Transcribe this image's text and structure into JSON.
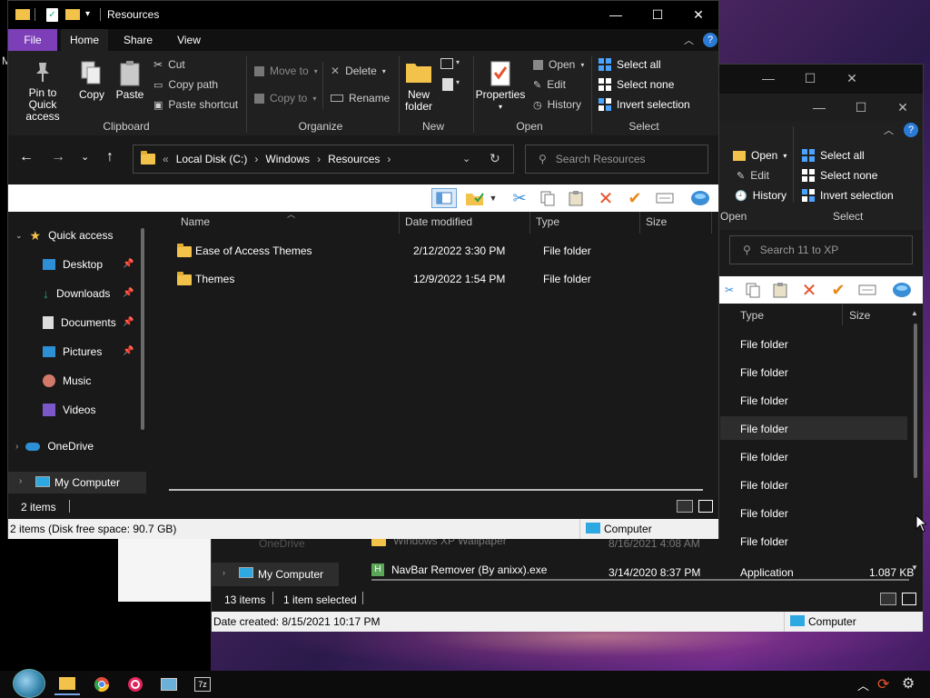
{
  "front": {
    "title": "Resources",
    "tabs": {
      "file": "File",
      "home": "Home",
      "share": "Share",
      "view": "View"
    },
    "ribbon": {
      "clipboard": {
        "label": "Clipboard",
        "pin": "Pin to Quick access",
        "copy": "Copy",
        "paste": "Paste",
        "cut": "Cut",
        "copy_path": "Copy path",
        "paste_shortcut": "Paste shortcut"
      },
      "organize": {
        "label": "Organize",
        "move_to": "Move to",
        "copy_to": "Copy to",
        "delete": "Delete",
        "rename": "Rename"
      },
      "new": {
        "label": "New",
        "new_folder": "New folder"
      },
      "open": {
        "label": "Open",
        "properties": "Properties",
        "open": "Open",
        "edit": "Edit",
        "history": "History"
      },
      "select": {
        "label": "Select",
        "select_all": "Select all",
        "select_none": "Select none",
        "invert": "Invert selection"
      }
    },
    "address": {
      "sep": "«",
      "crumbs": [
        "Local Disk (C:)",
        "Windows",
        "Resources"
      ]
    },
    "search_placeholder": "Search Resources",
    "nav": {
      "quick_access": "Quick access",
      "items": [
        "Desktop",
        "Downloads",
        "Documents",
        "Pictures",
        "Music",
        "Videos"
      ],
      "onedrive": "OneDrive",
      "my_computer": "My Computer"
    },
    "columns": {
      "name": "Name",
      "date": "Date modified",
      "type": "Type",
      "size": "Size"
    },
    "rows": [
      {
        "name": "Ease of Access Themes",
        "date": "2/12/2022 3:30 PM",
        "type": "File folder",
        "size": ""
      },
      {
        "name": "Themes",
        "date": "12/9/2022 1:54 PM",
        "type": "File folder",
        "size": ""
      }
    ],
    "status": "2 items",
    "footer": "2 items (Disk free space: 90.7 GB)",
    "footer_right": "Computer"
  },
  "back": {
    "open": "Open",
    "edit": "Edit",
    "history": "History",
    "select_all": "Select all",
    "select_none": "Select none",
    "invert": "Invert selection",
    "open_label": "Open",
    "select_label": "Select",
    "search_placeholder": "Search 11 to XP",
    "col_type": "Type",
    "col_size": "Size",
    "types": [
      "File folder",
      "File folder",
      "File folder",
      "File folder",
      "File folder",
      "File folder",
      "File folder",
      "File folder"
    ],
    "partial_onedrive": "OneDrive",
    "row_wallpaper": {
      "name": "Windows XP Wallpaper",
      "date": "8/16/2021 4:08 AM"
    },
    "row_navbar": {
      "name": "NavBar Remover (By anixx).exe",
      "date": "3/14/2020 8:37 PM",
      "type": "Application",
      "size": "1.087 KB"
    },
    "my_computer": "My Computer",
    "status_items": "13 items",
    "status_selected": "1 item selected",
    "footer": "Date created: 8/15/2021 10:17 PM",
    "footer_right": "Computer"
  },
  "desktop_partial": "M"
}
